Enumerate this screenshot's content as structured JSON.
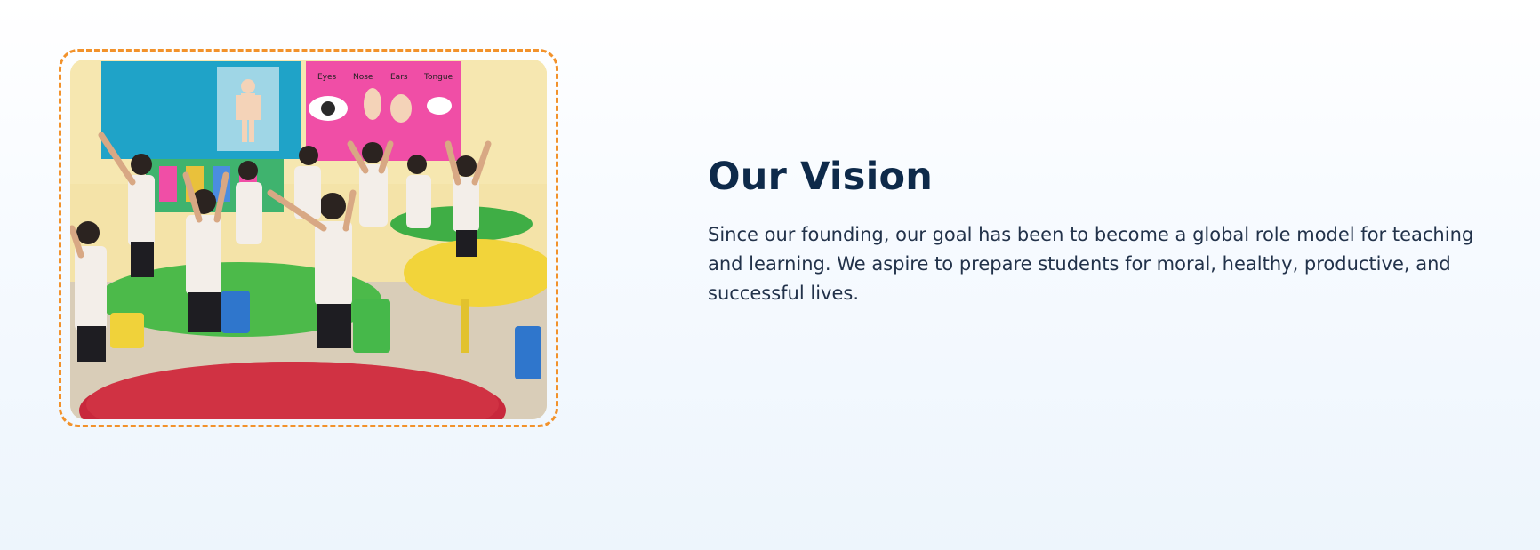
{
  "vision": {
    "heading": "Our Vision",
    "paragraph": "Since our founding, our goal has been to become a global role model for teaching and learning. We aspire to prepare students for moral, healthy, productive, and successful lives."
  },
  "image": {
    "alt": "Children doing stretching exercises in a classroom",
    "poster_labels": [
      "Eyes",
      "Nose",
      "Ears",
      "Tongue"
    ]
  },
  "colors": {
    "frame_border": "#f2922b",
    "heading": "#0e2a4a",
    "body_text": "#22324a",
    "table_red": "#c8283c",
    "table_green": "#4cba4a",
    "table_yellow": "#f2d43a",
    "board_blue": "#1fa3c8",
    "board_pink": "#f04ea6"
  }
}
